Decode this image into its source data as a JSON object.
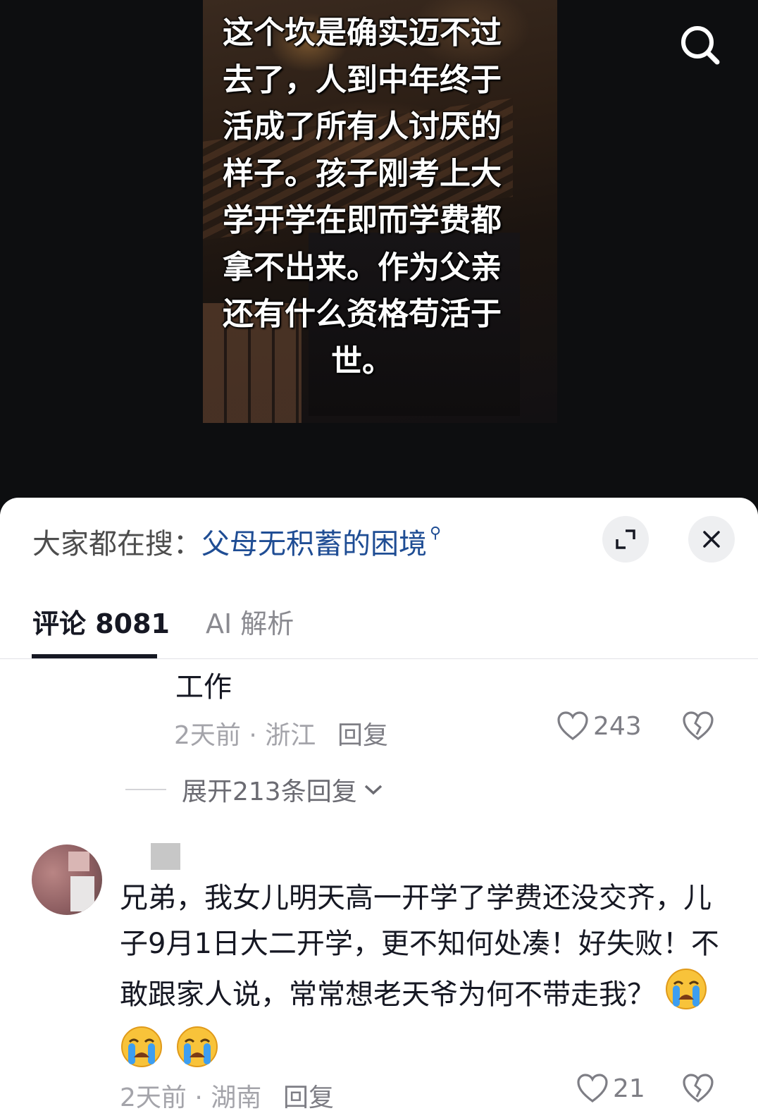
{
  "video": {
    "caption": "这个坎是确实迈不过去了，人到中年终于活成了所有人讨厌的样子。孩子刚考上大学开学在即而学费都拿不出来。作为父亲还有什么资格苟活于世。"
  },
  "search_bar": {
    "prefix": "大家都在搜：",
    "query": "父母无积蓄的困境",
    "query_icon": "magnifier-icon"
  },
  "tabs": [
    {
      "label": "评论 8081",
      "active": true
    },
    {
      "label": "AI 解析",
      "active": false
    }
  ],
  "comments": [
    {
      "text": "工作",
      "time_location": "2天前 · 浙江",
      "reply_label": "回复",
      "likes": "243",
      "expand_replies": "展开213条回复"
    },
    {
      "text": "兄弟，我女儿明天高一开学了学费还没交齐，儿子9月1日大二开学，更不知何处凑！好失败！不敢跟家人说，常常想老天爷为何不带走我？",
      "emoji": [
        "crying-face-icon",
        "crying-face-icon",
        "crying-face-icon"
      ],
      "time_location": "2天前 · 湖南",
      "reply_label": "回复",
      "likes": "21"
    }
  ],
  "colors": {
    "query_link": "#1f4d94",
    "text_primary": "#161823",
    "text_secondary": "#a4a4aa",
    "video_background": "#0d0e10"
  }
}
